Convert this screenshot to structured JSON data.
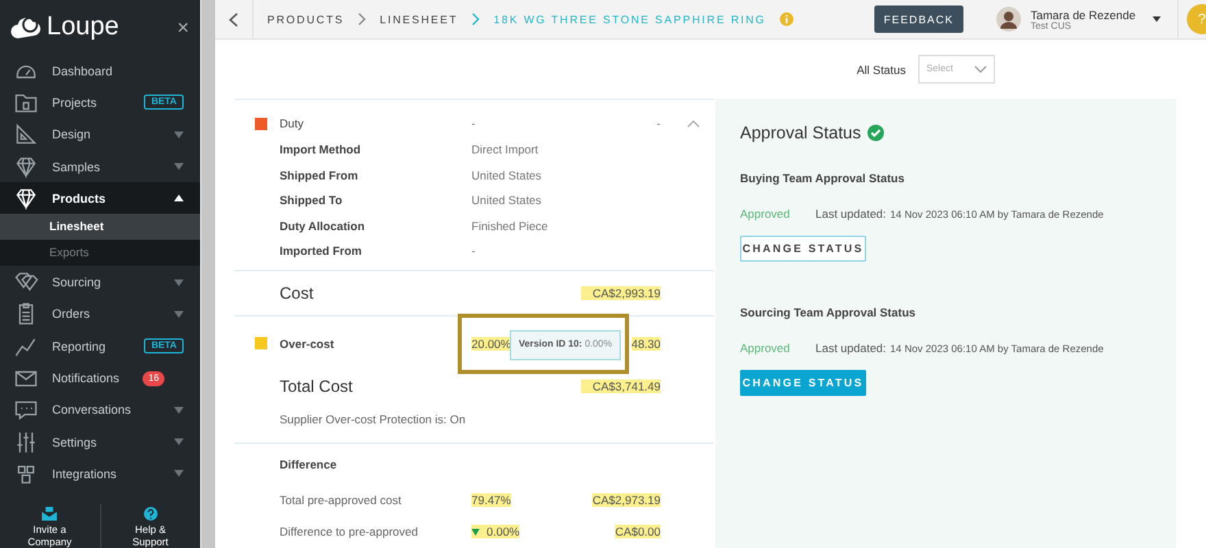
{
  "sidebar": {
    "logo": "Loupe",
    "close": "×",
    "items": [
      {
        "label": "Dashboard",
        "selected": false
      },
      {
        "label": "Projects",
        "badge": "BETA",
        "selected": false
      },
      {
        "label": "Design",
        "expanded": false,
        "selected": false
      },
      {
        "label": "Samples",
        "expanded": false,
        "selected": false
      },
      {
        "label": "Products",
        "expanded": true,
        "selected": true,
        "children": [
          {
            "label": "Linesheet",
            "selected": true
          },
          {
            "label": "Exports",
            "selected": false
          }
        ]
      },
      {
        "label": "Sourcing",
        "expanded": false,
        "selected": false
      },
      {
        "label": "Orders",
        "expanded": false,
        "selected": false
      },
      {
        "label": "Reporting",
        "badge": "BETA",
        "selected": false
      },
      {
        "label": "Notifications",
        "count": "16",
        "selected": false
      },
      {
        "label": "Conversations",
        "expanded": false,
        "selected": false
      },
      {
        "label": "Settings",
        "expanded": false,
        "selected": false
      },
      {
        "label": "Integrations",
        "expanded": false,
        "selected": false
      }
    ],
    "actions": [
      {
        "label": "Invite a Company"
      },
      {
        "label": "Help & Support"
      }
    ]
  },
  "topbar": {
    "breadcrumbs": [
      {
        "label": "PRODUCTS",
        "selected": false
      },
      {
        "label": "LINESHEET",
        "selected": false
      },
      {
        "label": "18K WG THREE STONE SAPPHIRE RING",
        "selected": true
      }
    ],
    "feedback": "FEEDBACK",
    "user": {
      "name": "Tamara de Rezende",
      "org": "Test CUS"
    },
    "help": "?"
  },
  "filter": {
    "label": "All Status",
    "placeholder": "Select"
  },
  "costs": {
    "duty": {
      "label": "Duty",
      "color": "#f05a28",
      "middle": "-",
      "value": "-",
      "expanded": true,
      "details": [
        {
          "label": "Import Method",
          "value": "Direct Import"
        },
        {
          "label": "Shipped From",
          "value": "United States"
        },
        {
          "label": "Shipped To",
          "value": "United States"
        },
        {
          "label": "Duty Allocation",
          "value": "Finished Piece"
        },
        {
          "label": "Imported From",
          "value": "-"
        }
      ]
    },
    "cost": {
      "label": "Cost",
      "value": "CA$2,993.19"
    },
    "overcost": {
      "label": "Over-cost",
      "color": "#f7c81e",
      "middle": "20.00%",
      "value": "48.30",
      "tooltip_label": "Version ID 10:",
      "tooltip_value": "0.00%"
    },
    "total": {
      "label": "Total Cost",
      "value": "CA$3,741.49"
    },
    "protection": "Supplier Over-cost Protection is: On",
    "difference": {
      "title": "Difference",
      "rows": [
        {
          "label": "Total pre-approved cost",
          "middle": "79.47%",
          "value": "CA$2,973.19",
          "trend_down": false
        },
        {
          "label": "Difference to pre-approved",
          "middle": "0.00%",
          "value": "CA$0.00",
          "trend_down": true
        }
      ]
    }
  },
  "approval": {
    "title": "Approval Status",
    "approved": true,
    "sections": [
      {
        "heading": "Buying Team Approval Status",
        "status": "Approved",
        "updated_label": "Last updated:",
        "updated": "14 Nov 2023 06:10 AM by Tamara de Rezende",
        "button": "CHANGE STATUS",
        "kind": "outline"
      },
      {
        "heading": "Sourcing Team Approval Status",
        "status": "Approved",
        "updated_label": "Last updated:",
        "updated": "14 Nov 2023 06:10 AM by Tamara de Rezende",
        "button": "CHANGE STATUS",
        "kind": "filled"
      }
    ]
  }
}
